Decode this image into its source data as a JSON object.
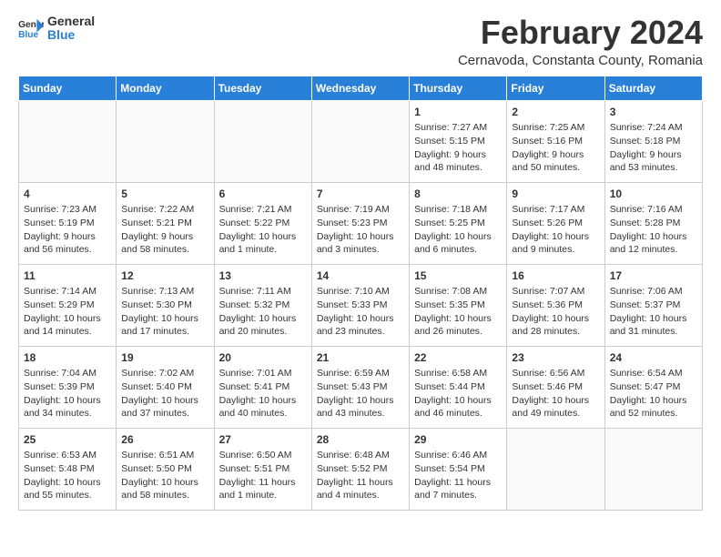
{
  "header": {
    "logo_line1": "General",
    "logo_line2": "Blue",
    "month_year": "February 2024",
    "location": "Cernavoda, Constanta County, Romania"
  },
  "days_of_week": [
    "Sunday",
    "Monday",
    "Tuesday",
    "Wednesday",
    "Thursday",
    "Friday",
    "Saturday"
  ],
  "weeks": [
    [
      {
        "day": "",
        "info": ""
      },
      {
        "day": "",
        "info": ""
      },
      {
        "day": "",
        "info": ""
      },
      {
        "day": "",
        "info": ""
      },
      {
        "day": "1",
        "info": "Sunrise: 7:27 AM\nSunset: 5:15 PM\nDaylight: 9 hours and 48 minutes."
      },
      {
        "day": "2",
        "info": "Sunrise: 7:25 AM\nSunset: 5:16 PM\nDaylight: 9 hours and 50 minutes."
      },
      {
        "day": "3",
        "info": "Sunrise: 7:24 AM\nSunset: 5:18 PM\nDaylight: 9 hours and 53 minutes."
      }
    ],
    [
      {
        "day": "4",
        "info": "Sunrise: 7:23 AM\nSunset: 5:19 PM\nDaylight: 9 hours and 56 minutes."
      },
      {
        "day": "5",
        "info": "Sunrise: 7:22 AM\nSunset: 5:21 PM\nDaylight: 9 hours and 58 minutes."
      },
      {
        "day": "6",
        "info": "Sunrise: 7:21 AM\nSunset: 5:22 PM\nDaylight: 10 hours and 1 minute."
      },
      {
        "day": "7",
        "info": "Sunrise: 7:19 AM\nSunset: 5:23 PM\nDaylight: 10 hours and 3 minutes."
      },
      {
        "day": "8",
        "info": "Sunrise: 7:18 AM\nSunset: 5:25 PM\nDaylight: 10 hours and 6 minutes."
      },
      {
        "day": "9",
        "info": "Sunrise: 7:17 AM\nSunset: 5:26 PM\nDaylight: 10 hours and 9 minutes."
      },
      {
        "day": "10",
        "info": "Sunrise: 7:16 AM\nSunset: 5:28 PM\nDaylight: 10 hours and 12 minutes."
      }
    ],
    [
      {
        "day": "11",
        "info": "Sunrise: 7:14 AM\nSunset: 5:29 PM\nDaylight: 10 hours and 14 minutes."
      },
      {
        "day": "12",
        "info": "Sunrise: 7:13 AM\nSunset: 5:30 PM\nDaylight: 10 hours and 17 minutes."
      },
      {
        "day": "13",
        "info": "Sunrise: 7:11 AM\nSunset: 5:32 PM\nDaylight: 10 hours and 20 minutes."
      },
      {
        "day": "14",
        "info": "Sunrise: 7:10 AM\nSunset: 5:33 PM\nDaylight: 10 hours and 23 minutes."
      },
      {
        "day": "15",
        "info": "Sunrise: 7:08 AM\nSunset: 5:35 PM\nDaylight: 10 hours and 26 minutes."
      },
      {
        "day": "16",
        "info": "Sunrise: 7:07 AM\nSunset: 5:36 PM\nDaylight: 10 hours and 28 minutes."
      },
      {
        "day": "17",
        "info": "Sunrise: 7:06 AM\nSunset: 5:37 PM\nDaylight: 10 hours and 31 minutes."
      }
    ],
    [
      {
        "day": "18",
        "info": "Sunrise: 7:04 AM\nSunset: 5:39 PM\nDaylight: 10 hours and 34 minutes."
      },
      {
        "day": "19",
        "info": "Sunrise: 7:02 AM\nSunset: 5:40 PM\nDaylight: 10 hours and 37 minutes."
      },
      {
        "day": "20",
        "info": "Sunrise: 7:01 AM\nSunset: 5:41 PM\nDaylight: 10 hours and 40 minutes."
      },
      {
        "day": "21",
        "info": "Sunrise: 6:59 AM\nSunset: 5:43 PM\nDaylight: 10 hours and 43 minutes."
      },
      {
        "day": "22",
        "info": "Sunrise: 6:58 AM\nSunset: 5:44 PM\nDaylight: 10 hours and 46 minutes."
      },
      {
        "day": "23",
        "info": "Sunrise: 6:56 AM\nSunset: 5:46 PM\nDaylight: 10 hours and 49 minutes."
      },
      {
        "day": "24",
        "info": "Sunrise: 6:54 AM\nSunset: 5:47 PM\nDaylight: 10 hours and 52 minutes."
      }
    ],
    [
      {
        "day": "25",
        "info": "Sunrise: 6:53 AM\nSunset: 5:48 PM\nDaylight: 10 hours and 55 minutes."
      },
      {
        "day": "26",
        "info": "Sunrise: 6:51 AM\nSunset: 5:50 PM\nDaylight: 10 hours and 58 minutes."
      },
      {
        "day": "27",
        "info": "Sunrise: 6:50 AM\nSunset: 5:51 PM\nDaylight: 11 hours and 1 minute."
      },
      {
        "day": "28",
        "info": "Sunrise: 6:48 AM\nSunset: 5:52 PM\nDaylight: 11 hours and 4 minutes."
      },
      {
        "day": "29",
        "info": "Sunrise: 6:46 AM\nSunset: 5:54 PM\nDaylight: 11 hours and 7 minutes."
      },
      {
        "day": "",
        "info": ""
      },
      {
        "day": "",
        "info": ""
      }
    ]
  ]
}
